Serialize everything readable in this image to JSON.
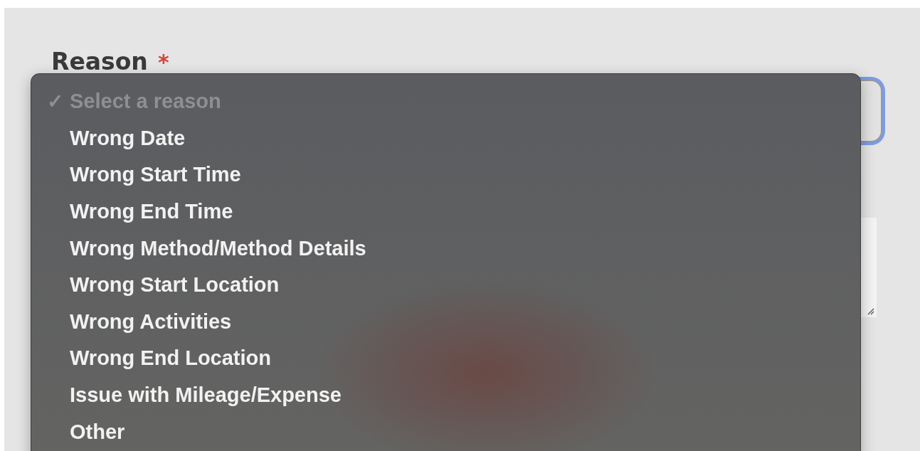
{
  "field": {
    "label": "Reason",
    "required_mark": "*",
    "focused": true
  },
  "menu": {
    "check_mark": "✓",
    "options": [
      {
        "label": "Select a reason",
        "selected": true,
        "disabled": true
      },
      {
        "label": "Wrong Date",
        "selected": false,
        "disabled": false
      },
      {
        "label": "Wrong Start Time",
        "selected": false,
        "disabled": false
      },
      {
        "label": "Wrong End Time",
        "selected": false,
        "disabled": false
      },
      {
        "label": "Wrong Method/Method Details",
        "selected": false,
        "disabled": false
      },
      {
        "label": "Wrong Start Location",
        "selected": false,
        "disabled": false
      },
      {
        "label": "Wrong Activities",
        "selected": false,
        "disabled": false
      },
      {
        "label": "Wrong End Location",
        "selected": false,
        "disabled": false
      },
      {
        "label": "Issue with Mileage/Expense",
        "selected": false,
        "disabled": false
      },
      {
        "label": "Other",
        "selected": false,
        "disabled": false
      }
    ]
  }
}
